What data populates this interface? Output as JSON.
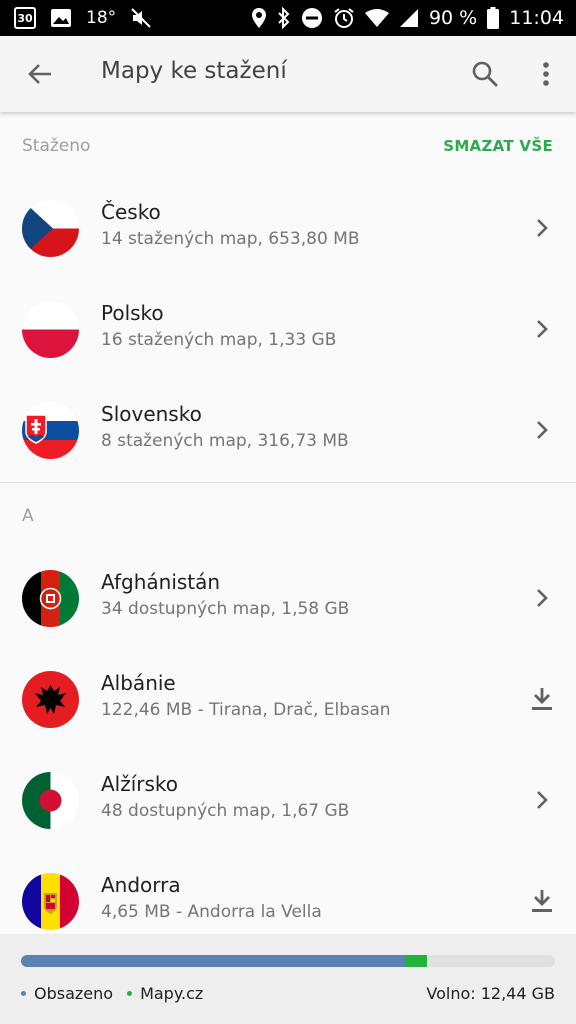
{
  "status_bar": {
    "calendar_day": "30",
    "temperature": "18°",
    "battery": "90 %",
    "time": "11:04",
    "icons_left": [
      "calendar-icon",
      "image-icon",
      "mute-icon"
    ],
    "icons_right": [
      "location-icon",
      "bluetooth-icon",
      "dnd-icon",
      "alarm-icon",
      "wifi-icon",
      "signal-icon",
      "battery-icon"
    ]
  },
  "toolbar": {
    "title": "Mapy ke stažení",
    "icons": [
      "back-arrow-icon",
      "search-icon",
      "more-vert-icon"
    ]
  },
  "downloaded": {
    "header": "Staženo",
    "delete_all": "SMAZAT VŠE",
    "items": [
      {
        "title": "Česko",
        "subtitle": "14 stažených map, 653,80 MB",
        "flag": "cz",
        "action": "chevron-right-icon"
      },
      {
        "title": "Polsko",
        "subtitle": "16 stažených map, 1,33 GB",
        "flag": "pl",
        "action": "chevron-right-icon"
      },
      {
        "title": "Slovensko",
        "subtitle": "8 stažených map, 316,73 MB",
        "flag": "sk",
        "action": "chevron-right-icon"
      }
    ]
  },
  "section_a": {
    "header": "A",
    "items": [
      {
        "title": "Afghánistán",
        "subtitle": "34 dostupných map, 1,58 GB",
        "flag": "af",
        "action": "chevron-right-icon"
      },
      {
        "title": "Albánie",
        "subtitle": "122,46 MB - Tirana, Drač, Elbasan",
        "flag": "al",
        "action": "download-icon"
      },
      {
        "title": "Alžírsko",
        "subtitle": "48 dostupných map, 1,67 GB",
        "flag": "dz",
        "action": "chevron-right-icon"
      },
      {
        "title": "Andorra",
        "subtitle": "4,65 MB - Andorra la Vella",
        "flag": "ad",
        "action": "download-icon"
      }
    ]
  },
  "storage": {
    "used_fraction": 0.72,
    "app_fraction": 0.04,
    "legend_used": "Obsazeno",
    "legend_app": "Mapy.cz",
    "free_label": "Volno: 12,44 GB",
    "colors": {
      "used": "#5b82b5",
      "app": "#23b33a",
      "accent": "#2eaa4e"
    }
  }
}
